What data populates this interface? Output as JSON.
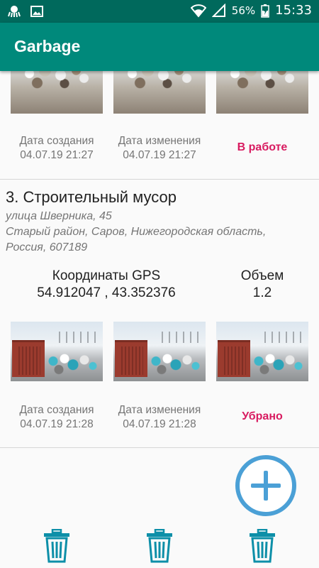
{
  "status_bar": {
    "battery_percent": "56%",
    "time": "15:33",
    "icons": [
      "octopus-icon",
      "image-icon",
      "wifi-icon",
      "signal-icon",
      "battery-icon"
    ]
  },
  "app_bar": {
    "title": "Garbage"
  },
  "card_top": {
    "created_label": "Дата создания",
    "created_value": "04.07.19 21:27",
    "modified_label": "Дата изменения",
    "modified_value": "04.07.19 21:27",
    "status": "В работе"
  },
  "card_3": {
    "title": "3. Строительный мусор",
    "address_line1": "улица Шверника, 45",
    "address_line2": "Старый район, Саров, Нижегородская область,",
    "address_line3": "Россия, 607189",
    "gps_label": "Координаты GPS",
    "gps_value": "54.912047 , 43.352376",
    "volume_label": "Объем",
    "volume_value": "1.2",
    "created_label": "Дата создания",
    "created_value": "04.07.19 21:28",
    "modified_label": "Дата изменения",
    "modified_value": "04.07.19 21:28",
    "status": "Убрано"
  },
  "colors": {
    "status_bar": "#00695c",
    "app_bar": "#00897b",
    "status_text": "#d81b60",
    "fab": "#4ba0d6",
    "trash_icon": "#0d8fa8"
  }
}
